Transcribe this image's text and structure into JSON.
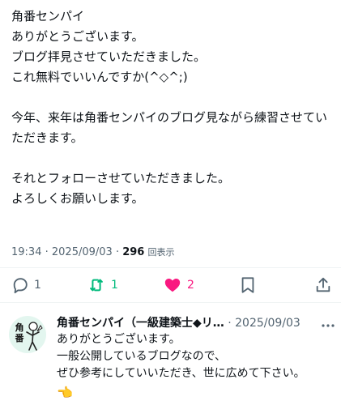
{
  "post": {
    "text": "角番センパイ\nありがとうございます。\nブログ拝見させていただきました。\nこれ無料でいいんですか(^◇^;)\n\n今年、来年は角番センパイのブログ見ながら練習させていただきます。\n\nそれとフォローさせていただきました。\nよろしくお願いします。",
    "time": "19:34",
    "date": "2025/09/03",
    "views": "296",
    "views_label": "回表示"
  },
  "actions": {
    "reply_count": "1",
    "repost_count": "1",
    "like_count": "2",
    "colors": {
      "repost": "#00ba7c",
      "like": "#f91880",
      "neutral": "#536471"
    }
  },
  "reply": {
    "author": "角番センパイ（一級建築士◆リ…",
    "date": "2025/09/03",
    "avatar_text": "角番",
    "text": "ありがとうございます。\n一般公開しているブログなので、\nぜひ参考にしていいただき、世に広めて下さい。",
    "emoji": "👈"
  }
}
